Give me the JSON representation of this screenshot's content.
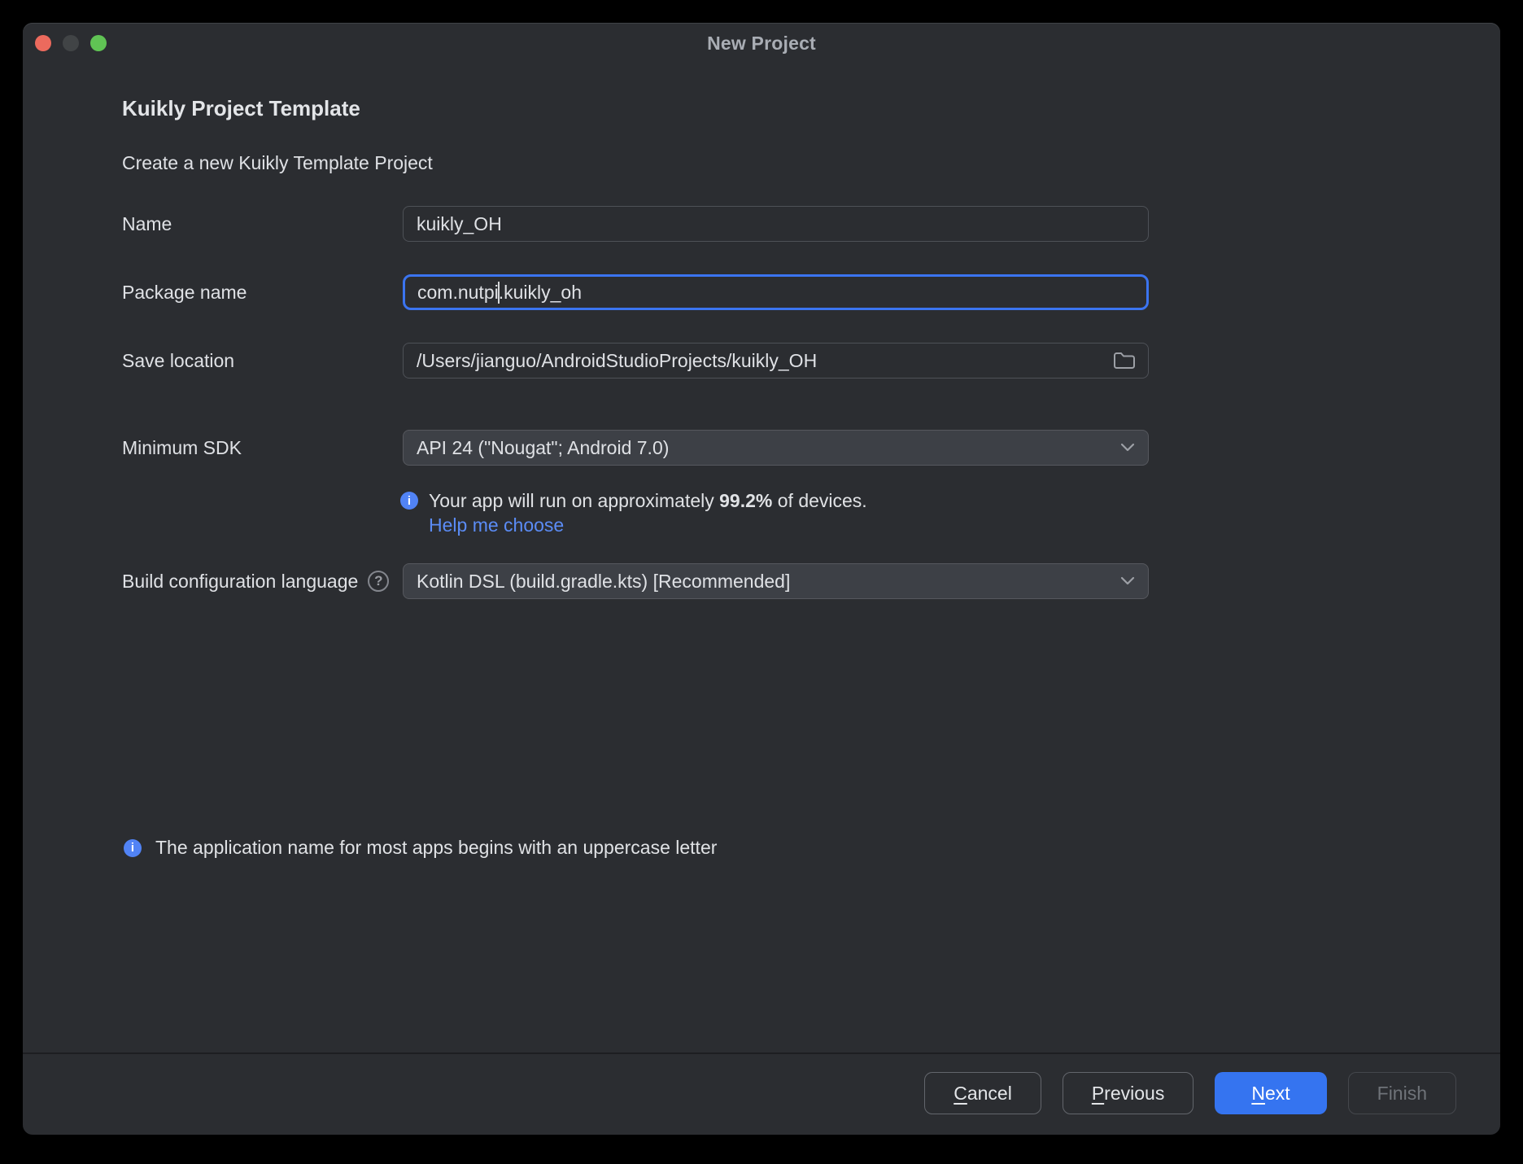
{
  "window": {
    "title": "New Project"
  },
  "traffic_lights": {
    "close_color": "#ec6a5d",
    "minimize_color": "#414446",
    "zoom_color": "#60c354"
  },
  "header": {
    "heading": "Kuikly Project Template",
    "subheading": "Create a new Kuikly Template Project"
  },
  "form": {
    "name": {
      "label": "Name",
      "value": "kuikly_OH"
    },
    "package": {
      "label": "Package name",
      "value": "com.nutpi.kuikly_oh",
      "value_before_caret": "com.nutpi",
      "value_after_caret": ".kuikly_oh"
    },
    "save_location": {
      "label": "Save location",
      "value": "/Users/jianguo/AndroidStudioProjects/kuikly_OH"
    },
    "min_sdk": {
      "label": "Minimum SDK",
      "value": "API 24 (\"Nougat\"; Android 7.0)"
    },
    "sdk_info": {
      "text_prefix": "Your app will run on approximately ",
      "percent": "99.2%",
      "text_suffix": " of devices.",
      "link": "Help me choose"
    },
    "build_config": {
      "label": "Build configuration language",
      "help_glyph": "?",
      "value": "Kotlin DSL (build.gradle.kts) [Recommended]"
    }
  },
  "footnote": {
    "text": "The application name for most apps begins with an uppercase letter"
  },
  "footer": {
    "cancel": {
      "mnemonic": "C",
      "rest": "ancel"
    },
    "previous": {
      "mnemonic": "P",
      "rest": "revious"
    },
    "next": {
      "mnemonic": "N",
      "rest": "ext"
    },
    "finish": {
      "label": "Finish"
    }
  },
  "icons": {
    "info": "i",
    "folder": "folder-outline",
    "chevron": "chevron-down"
  },
  "colors": {
    "accent": "#3574f0",
    "link": "#5b8cf6",
    "info_icon_bg": "#5183f5",
    "window_bg": "#2b2d31",
    "focus_border": "#3b74f0"
  }
}
